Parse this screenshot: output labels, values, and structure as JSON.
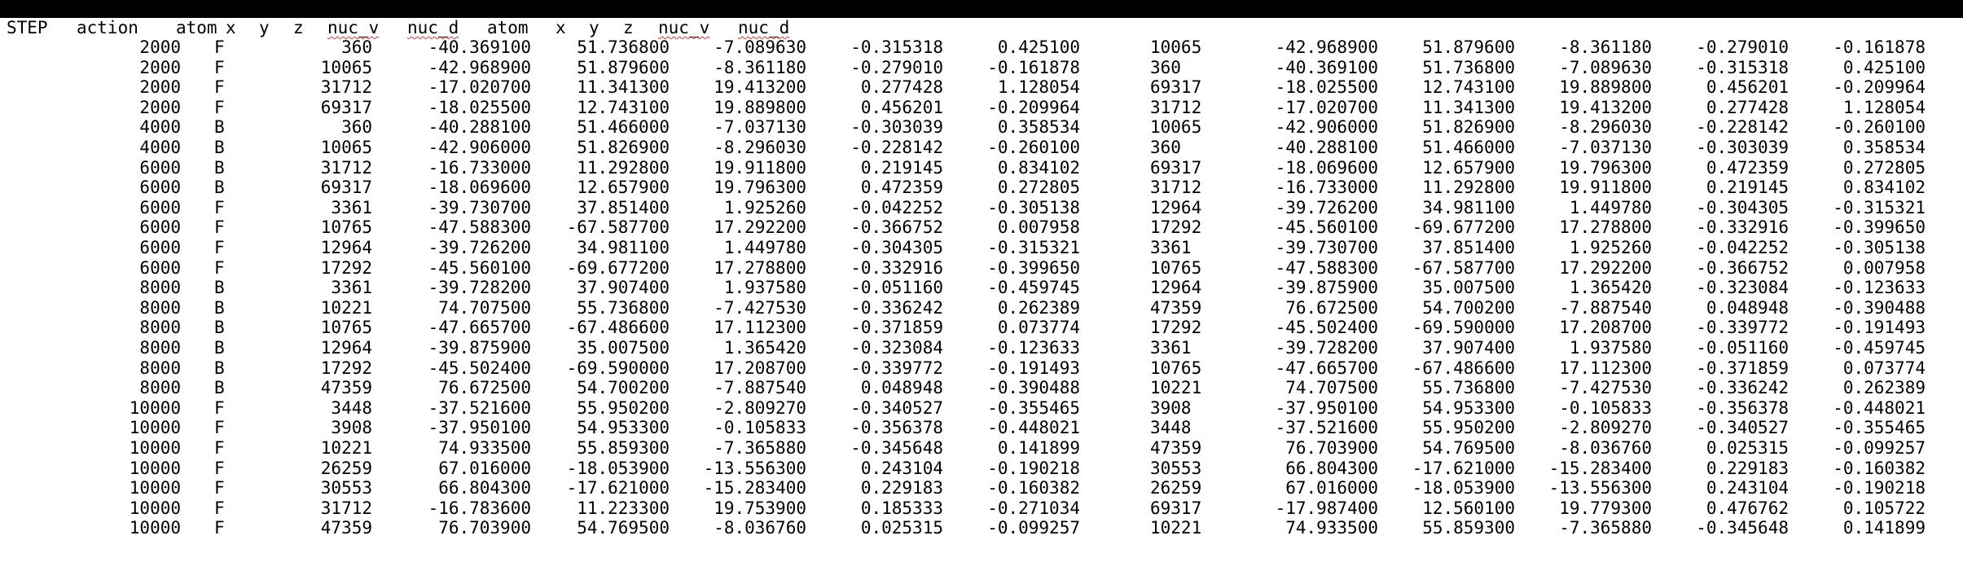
{
  "header": {
    "columns": [
      "STEP",
      "action",
      "atom",
      "x",
      "y",
      "z",
      "nuc_v",
      "nuc_d",
      "atom",
      "x",
      "y",
      "z",
      "nuc_v",
      "nuc_d"
    ]
  },
  "rows": [
    [
      "2000",
      "F",
      "360",
      "-40.369100",
      "51.736800",
      "-7.089630",
      "-0.315318",
      "0.425100",
      "10065",
      "-42.968900",
      "51.879600",
      "-8.361180",
      "-0.279010",
      "-0.161878"
    ],
    [
      "2000",
      "F",
      "10065",
      "-42.968900",
      "51.879600",
      "-8.361180",
      "-0.279010",
      "-0.161878",
      "360",
      "-40.369100",
      "51.736800",
      "-7.089630",
      "-0.315318",
      "0.425100"
    ],
    [
      "2000",
      "F",
      "31712",
      "-17.020700",
      "11.341300",
      "19.413200",
      "0.277428",
      "1.128054",
      "69317",
      "-18.025500",
      "12.743100",
      "19.889800",
      "0.456201",
      "-0.209964"
    ],
    [
      "2000",
      "F",
      "69317",
      "-18.025500",
      "12.743100",
      "19.889800",
      "0.456201",
      "-0.209964",
      "31712",
      "-17.020700",
      "11.341300",
      "19.413200",
      "0.277428",
      "1.128054"
    ],
    [
      "4000",
      "B",
      "360",
      "-40.288100",
      "51.466000",
      "-7.037130",
      "-0.303039",
      "0.358534",
      "10065",
      "-42.906000",
      "51.826900",
      "-8.296030",
      "-0.228142",
      "-0.260100"
    ],
    [
      "4000",
      "B",
      "10065",
      "-42.906000",
      "51.826900",
      "-8.296030",
      "-0.228142",
      "-0.260100",
      "360",
      "-40.288100",
      "51.466000",
      "-7.037130",
      "-0.303039",
      "0.358534"
    ],
    [
      "6000",
      "B",
      "31712",
      "-16.733000",
      "11.292800",
      "19.911800",
      "0.219145",
      "0.834102",
      "69317",
      "-18.069600",
      "12.657900",
      "19.796300",
      "0.472359",
      "0.272805"
    ],
    [
      "6000",
      "B",
      "69317",
      "-18.069600",
      "12.657900",
      "19.796300",
      "0.472359",
      "0.272805",
      "31712",
      "-16.733000",
      "11.292800",
      "19.911800",
      "0.219145",
      "0.834102"
    ],
    [
      "6000",
      "F",
      "3361",
      "-39.730700",
      "37.851400",
      "1.925260",
      "-0.042252",
      "-0.305138",
      "12964",
      "-39.726200",
      "34.981100",
      "1.449780",
      "-0.304305",
      "-0.315321"
    ],
    [
      "6000",
      "F",
      "10765",
      "-47.588300",
      "-67.587700",
      "17.292200",
      "-0.366752",
      "0.007958",
      "17292",
      "-45.560100",
      "-69.677200",
      "17.278800",
      "-0.332916",
      "-0.399650"
    ],
    [
      "6000",
      "F",
      "12964",
      "-39.726200",
      "34.981100",
      "1.449780",
      "-0.304305",
      "-0.315321",
      "3361",
      "-39.730700",
      "37.851400",
      "1.925260",
      "-0.042252",
      "-0.305138"
    ],
    [
      "6000",
      "F",
      "17292",
      "-45.560100",
      "-69.677200",
      "17.278800",
      "-0.332916",
      "-0.399650",
      "10765",
      "-47.588300",
      "-67.587700",
      "17.292200",
      "-0.366752",
      "0.007958"
    ],
    [
      "8000",
      "B",
      "3361",
      "-39.728200",
      "37.907400",
      "1.937580",
      "-0.051160",
      "-0.459745",
      "12964",
      "-39.875900",
      "35.007500",
      "1.365420",
      "-0.323084",
      "-0.123633"
    ],
    [
      "8000",
      "B",
      "10221",
      "74.707500",
      "55.736800",
      "-7.427530",
      "-0.336242",
      "0.262389",
      "47359",
      "76.672500",
      "54.700200",
      "-7.887540",
      "0.048948",
      "-0.390488"
    ],
    [
      "8000",
      "B",
      "10765",
      "-47.665700",
      "-67.486600",
      "17.112300",
      "-0.371859",
      "0.073774",
      "17292",
      "-45.502400",
      "-69.590000",
      "17.208700",
      "-0.339772",
      "-0.191493"
    ],
    [
      "8000",
      "B",
      "12964",
      "-39.875900",
      "35.007500",
      "1.365420",
      "-0.323084",
      "-0.123633",
      "3361",
      "-39.728200",
      "37.907400",
      "1.937580",
      "-0.051160",
      "-0.459745"
    ],
    [
      "8000",
      "B",
      "17292",
      "-45.502400",
      "-69.590000",
      "17.208700",
      "-0.339772",
      "-0.191493",
      "10765",
      "-47.665700",
      "-67.486600",
      "17.112300",
      "-0.371859",
      "0.073774"
    ],
    [
      "8000",
      "B",
      "47359",
      "76.672500",
      "54.700200",
      "-7.887540",
      "0.048948",
      "-0.390488",
      "10221",
      "74.707500",
      "55.736800",
      "-7.427530",
      "-0.336242",
      "0.262389"
    ],
    [
      "10000",
      "F",
      "3448",
      "-37.521600",
      "55.950200",
      "-2.809270",
      "-0.340527",
      "-0.355465",
      "3908",
      "-37.950100",
      "54.953300",
      "-0.105833",
      "-0.356378",
      "-0.448021"
    ],
    [
      "10000",
      "F",
      "3908",
      "-37.950100",
      "54.953300",
      "-0.105833",
      "-0.356378",
      "-0.448021",
      "3448",
      "-37.521600",
      "55.950200",
      "-2.809270",
      "-0.340527",
      "-0.355465"
    ],
    [
      "10000",
      "F",
      "10221",
      "74.933500",
      "55.859300",
      "-7.365880",
      "-0.345648",
      "0.141899",
      "47359",
      "76.703900",
      "54.769500",
      "-8.036760",
      "0.025315",
      "-0.099257"
    ],
    [
      "10000",
      "F",
      "26259",
      "67.016000",
      "-18.053900",
      "-13.556300",
      "0.243104",
      "-0.190218",
      "30553",
      "66.804300",
      "-17.621000",
      "-15.283400",
      "0.229183",
      "-0.160382"
    ],
    [
      "10000",
      "F",
      "30553",
      "66.804300",
      "-17.621000",
      "-15.283400",
      "0.229183",
      "-0.160382",
      "26259",
      "67.016000",
      "-18.053900",
      "-13.556300",
      "0.243104",
      "-0.190218"
    ],
    [
      "10000",
      "F",
      "31712",
      "-16.783600",
      "11.223300",
      "19.753900",
      "0.185333",
      "-0.271034",
      "69317",
      "-17.987400",
      "12.560100",
      "19.779300",
      "0.476762",
      "0.105722"
    ],
    [
      "10000",
      "F",
      "47359",
      "76.703900",
      "54.769500",
      "-8.036760",
      "0.025315",
      "-0.099257",
      "10221",
      "74.933500",
      "55.859300",
      "-7.365880",
      "-0.345648",
      "0.141899"
    ]
  ]
}
